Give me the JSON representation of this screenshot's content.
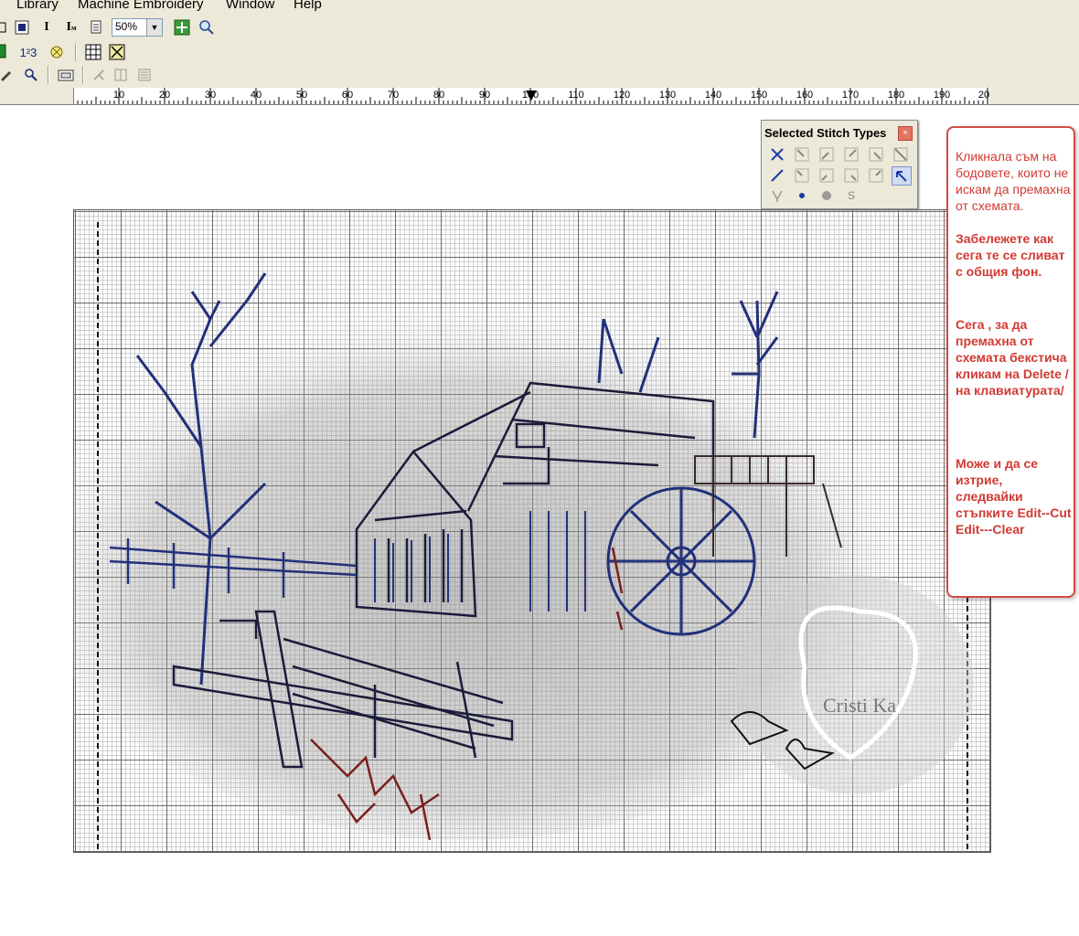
{
  "menubar": {
    "items": [
      "Library",
      "Machine Embroidery",
      "Window",
      "Help"
    ]
  },
  "toolbar": {
    "zoom_value": "50%",
    "num_label": "1²3",
    "icons": [
      "square-icon",
      "text-icon",
      "text-small-icon",
      "page-icon",
      "zoom-fit-icon",
      "zoom-icon",
      "green-square-icon",
      "number-icon",
      "stitch-icon",
      "grid-icon",
      "cross-icon",
      "pencil-icon",
      "magnifier-icon",
      "properties-icon",
      "split-icon",
      "columns-icon",
      "list-icon"
    ]
  },
  "ruler": {
    "labels": [
      "10",
      "20",
      "30",
      "40",
      "50",
      "60",
      "70",
      "80",
      "90",
      "100",
      "110",
      "120",
      "130",
      "140",
      "150",
      "160",
      "170",
      "180",
      "190",
      "20"
    ]
  },
  "stitch_panel": {
    "title": "Selected Stitch Types",
    "close_label": "×",
    "s_label": "S"
  },
  "note": {
    "normal_text": "Кликнала съм на бодовете, които не искам да премахна от схемата.",
    "bold_text_1": "Забележете как сега те се сливат с общия фон.",
    "bold_text_2": "Сега , за да премахна от схемата бекстича кликам на Delete /на клавиатурата/",
    "bold_text_3": "Може и да се изтрие, следвайки стъпките Edit--Cut Edit---Clear"
  },
  "watermark": {
    "text": "Cristi Ka"
  },
  "colors": {
    "ui_bg": "#ece9d8",
    "stitch_blue": "#22307a",
    "stitch_dark": "#1b1b3a",
    "stitch_red": "#7a1f1f",
    "note_red": "#d03a33"
  }
}
